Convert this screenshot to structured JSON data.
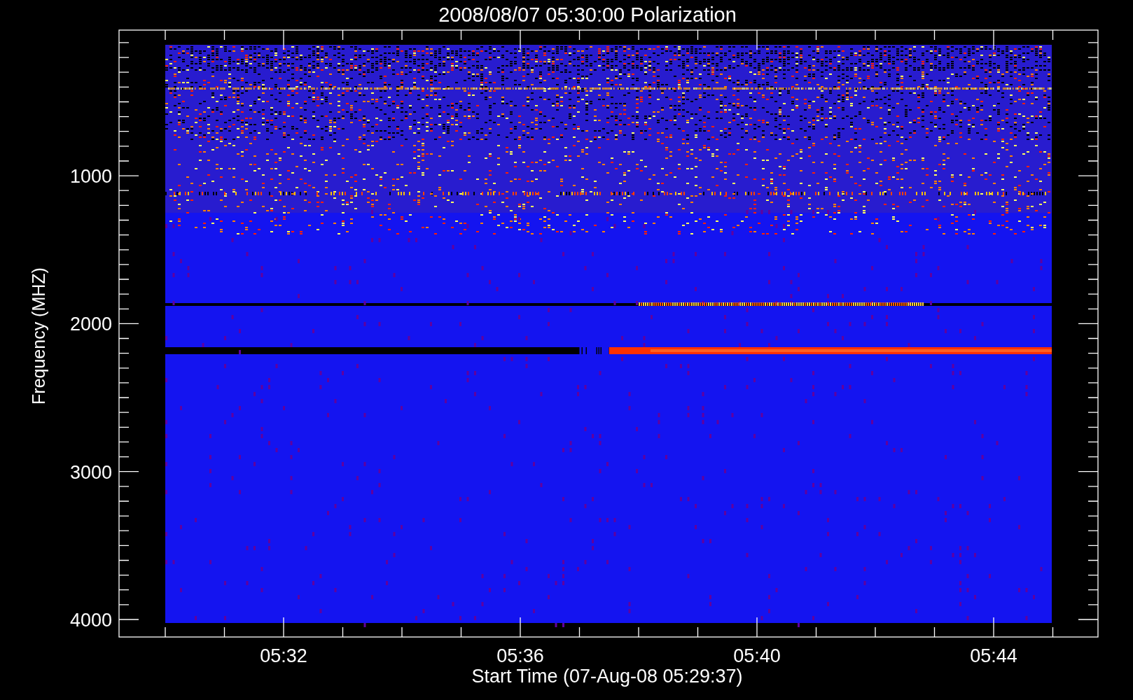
{
  "title": "2008/08/07 05:30:00 Polarization",
  "xlabel": "Start Time (07-Aug-08 05:29:37)",
  "ylabel": "Frequency (MHZ)",
  "yticks": [
    "1000",
    "2000",
    "3000",
    "4000"
  ],
  "xticks": [
    "05:32",
    "05:36",
    "05:40",
    "05:44"
  ]
}
